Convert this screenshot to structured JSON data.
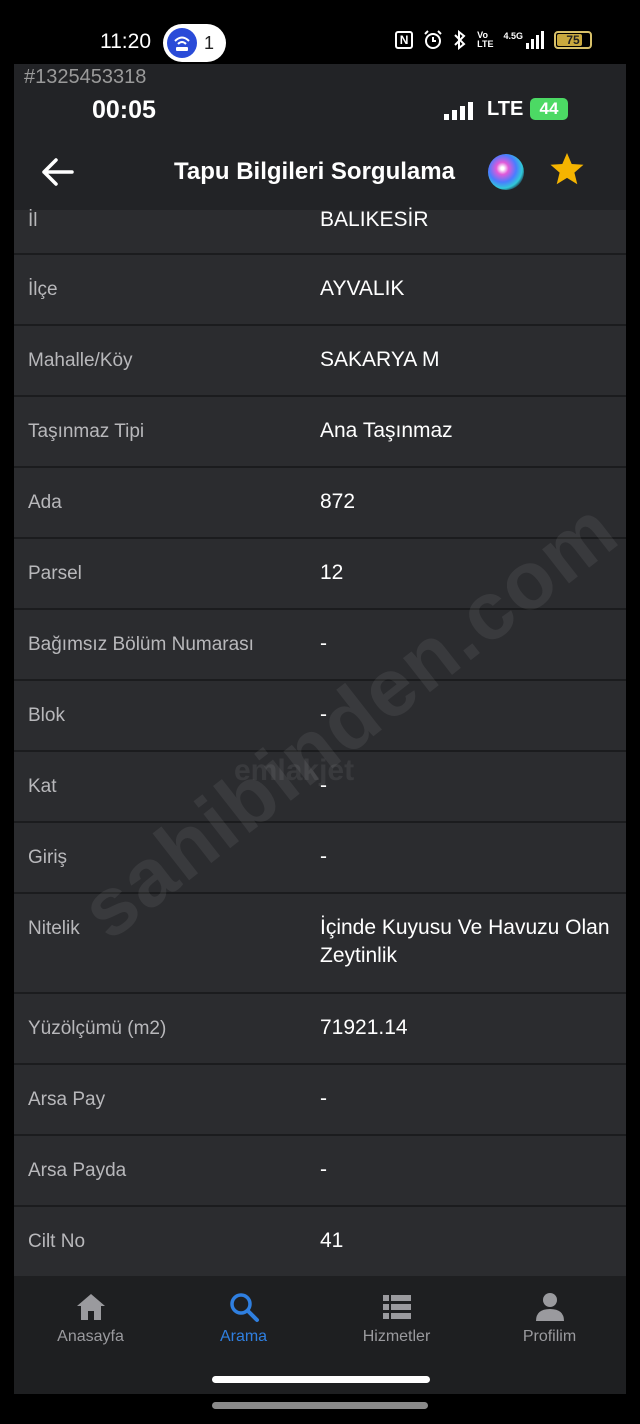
{
  "outer_status": {
    "time": "11:20",
    "hotspot_count": "1",
    "battery": "75",
    "network_label": "4.5G"
  },
  "recording": {
    "id": "#1325453318",
    "time": "00:05",
    "network": "LTE",
    "battery": "44"
  },
  "nav": {
    "title": "Tapu Bilgileri Sorgulama",
    "back_icon": "arrow-left-icon",
    "siri_icon": "siri-icon",
    "favorite_icon": "star-icon",
    "favorite_color": "#f5b400"
  },
  "rows": [
    {
      "label": "İl",
      "value": "BALIKESİR"
    },
    {
      "label": "İlçe",
      "value": "AYVALIK"
    },
    {
      "label": "Mahalle/Köy",
      "value": "SAKARYA M"
    },
    {
      "label": "Taşınmaz Tipi",
      "value": "Ana Taşınmaz"
    },
    {
      "label": "Ada",
      "value": "872"
    },
    {
      "label": "Parsel",
      "value": "12"
    },
    {
      "label": "Bağımsız Bölüm Numarası",
      "value": "-"
    },
    {
      "label": "Blok",
      "value": "-"
    },
    {
      "label": "Kat",
      "value": "-"
    },
    {
      "label": "Giriş",
      "value": "-"
    },
    {
      "label": "Nitelik",
      "value": "İçinde Kuyusu Ve Havuzu Olan Zeytinlik"
    },
    {
      "label": "Yüzölçümü (m2)",
      "value": "71921.14"
    },
    {
      "label": "Arsa Pay",
      "value": "-"
    },
    {
      "label": "Arsa Payda",
      "value": "-"
    },
    {
      "label": "Cilt No",
      "value": "41"
    }
  ],
  "watermark": {
    "text": "sahibinden.com",
    "sub": "emlakjet"
  },
  "tabs": [
    {
      "label": "Anasayfa",
      "icon": "home-icon"
    },
    {
      "label": "Arama",
      "icon": "search-icon",
      "active": true
    },
    {
      "label": "Hizmetler",
      "icon": "list-icon"
    },
    {
      "label": "Profilim",
      "icon": "person-icon"
    }
  ],
  "colors": {
    "accent": "#2f7fe0",
    "background": "#2b2c2f",
    "bars": "#222326"
  }
}
